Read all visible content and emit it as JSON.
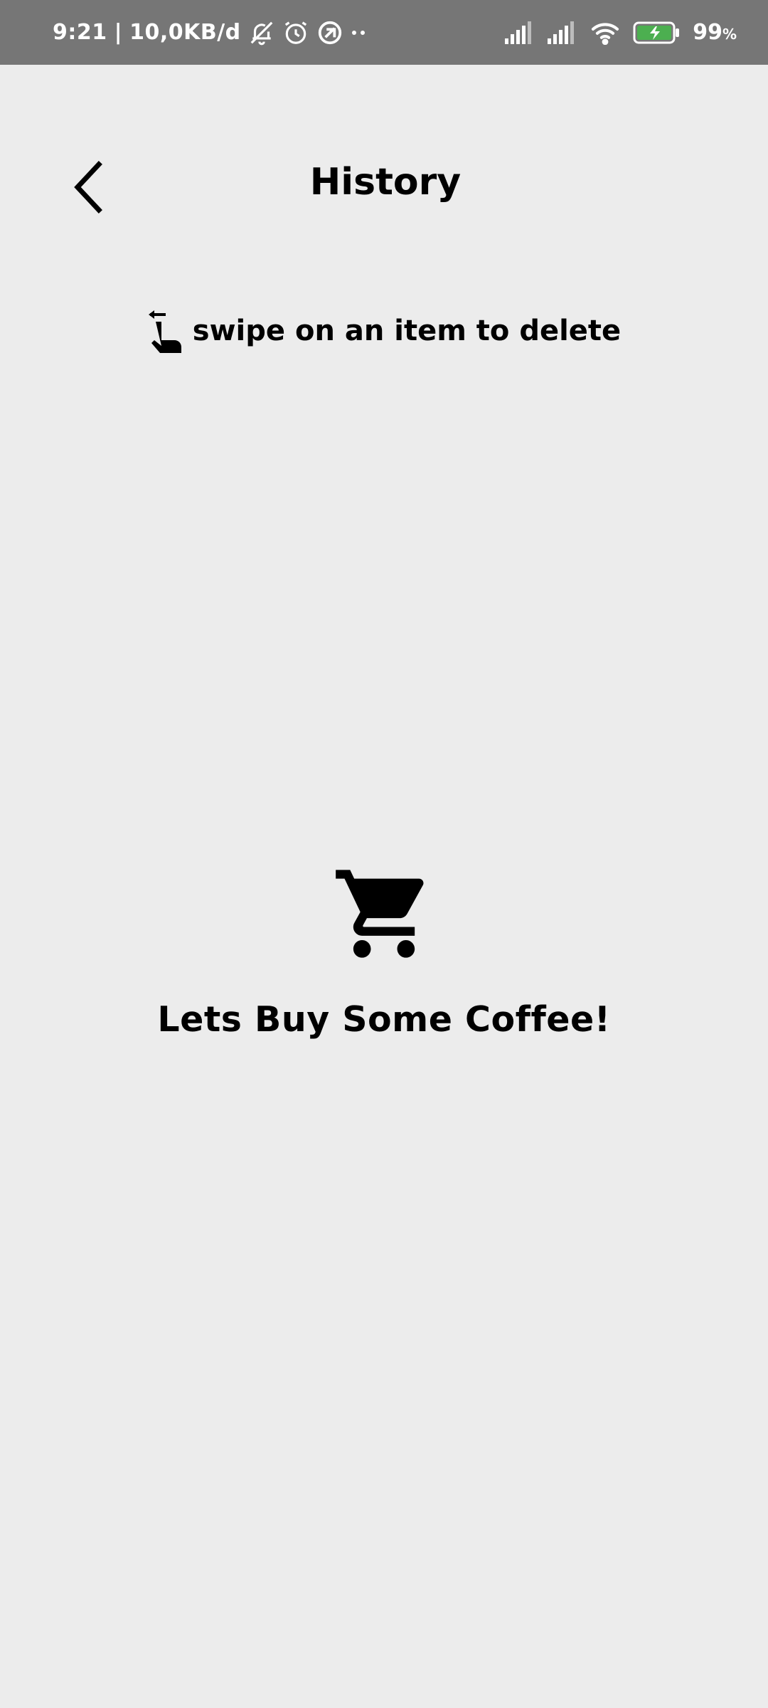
{
  "status_bar": {
    "time": "9:21",
    "separator": "|",
    "network_speed": "10,0KB/d",
    "battery_percent": "99",
    "battery_unit": "%",
    "icons": [
      "muted-bell-icon",
      "alarm-icon",
      "vpn-icon",
      "more-dots-icon",
      "signal-icon",
      "signal-icon",
      "wifi-icon",
      "battery-charging-icon"
    ]
  },
  "header": {
    "title": "History",
    "back_icon": "chevron-left-icon"
  },
  "hint": {
    "icon": "swipe-left-gesture-icon",
    "text": "swipe on an item to delete"
  },
  "empty_state": {
    "icon": "shopping-cart-icon",
    "title": "Lets Buy Some Coffee!"
  },
  "colors": {
    "background": "#ececec",
    "status_bar": "#767676",
    "text": "#000000",
    "battery_fill": "#4caf50"
  }
}
